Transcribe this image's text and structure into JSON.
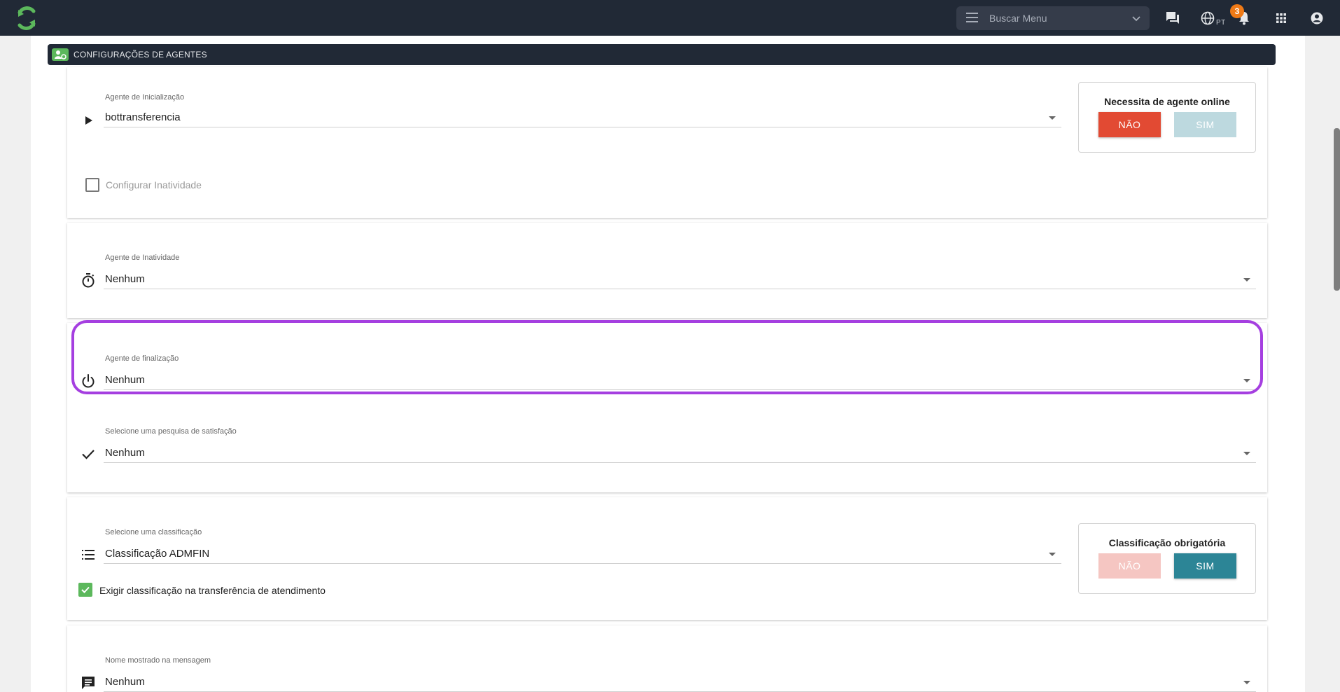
{
  "header": {
    "search_placeholder": "Buscar Menu",
    "language_code": "PT",
    "notification_count": "3"
  },
  "section": {
    "title": "CONFIGURAÇÕES DE AGENTES"
  },
  "init_agent": {
    "label": "Agente de Inicialização",
    "value": "bottransferencia",
    "online_box": {
      "title": "Necessita de agente online",
      "no_label": "NÃO",
      "yes_label": "SIM"
    },
    "inactivity_checkbox_label": "Configurar Inatividade"
  },
  "inactivity_agent": {
    "label": "Agente de Inatividade",
    "value": "Nenhum"
  },
  "finalization_agent": {
    "label": "Agente de finalização",
    "value": "Nenhum"
  },
  "satisfaction": {
    "label": "Selecione uma pesquisa de satisfação",
    "value": "Nenhum"
  },
  "classification": {
    "label": "Selecione uma classificação",
    "value": "Classificação ADMFIN",
    "required_box": {
      "title": "Classificação obrigatória",
      "no_label": "NÃO",
      "yes_label": "SIM"
    },
    "transfer_checkbox_label": "Exigir classificação na transferência de atendimento"
  },
  "message_name": {
    "label": "Nome mostrado na mensagem",
    "value": "Nenhum"
  },
  "colors": {
    "topbar": "#212936",
    "brand_green": "#5cb85c",
    "no_active": "#e24a33",
    "yes_active": "#2c8596",
    "highlight": "#a53fe0",
    "badge": "#f07a16"
  }
}
